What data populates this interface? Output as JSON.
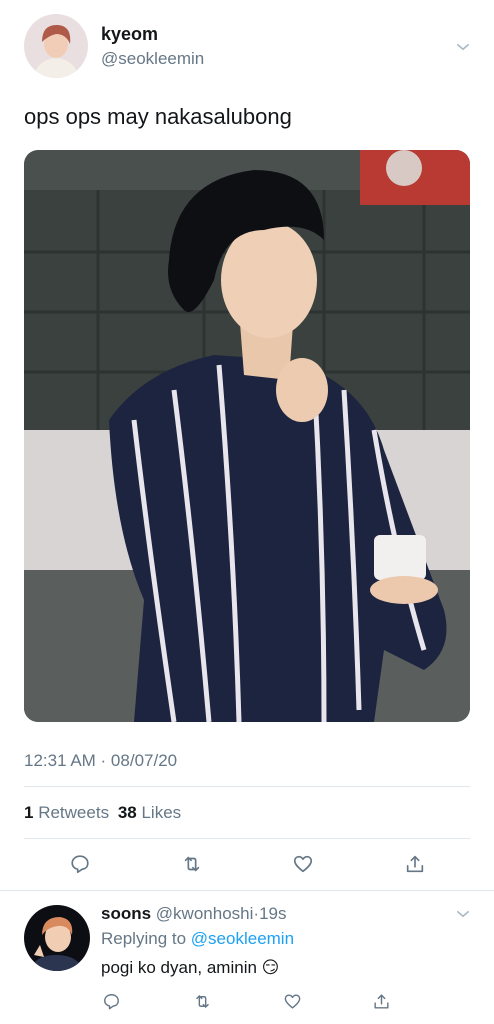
{
  "tweet": {
    "display_name": "kyeom",
    "handle": "@seokleemin",
    "text": "ops ops may nakasalubong",
    "timestamp": "12:31 AM · 08/07/20",
    "retweets_count": "1",
    "retweets_label": "Retweets",
    "likes_count": "38",
    "likes_label": "Likes"
  },
  "reply": {
    "display_name": "soons",
    "handle": "@kwonhoshi",
    "separator": "·",
    "time": "19s",
    "replying_to_label": "Replying to",
    "replying_to_handle": "@seokleemin",
    "text": "pogi ko dyan, aminin",
    "emoji": "😏"
  },
  "icons": {
    "reply": "reply-icon",
    "retweet": "retweet-icon",
    "like": "heart-icon",
    "share": "share-icon",
    "more": "chevron-down-icon"
  },
  "colors": {
    "accent": "#1da1f2",
    "muted": "#657786",
    "text": "#14171a",
    "divider": "#e1e8ed"
  }
}
